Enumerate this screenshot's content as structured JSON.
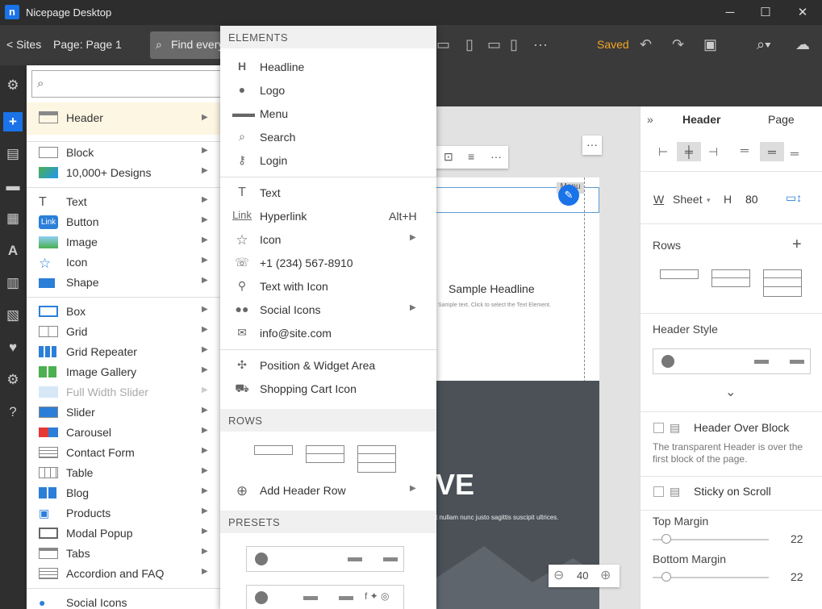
{
  "app": {
    "title": "Nicepage Desktop",
    "logo_letter": "n"
  },
  "toolbar": {
    "sites": "< Sites",
    "page": "Page: Page 1",
    "find_placeholder": "Find every",
    "status": "Saved"
  },
  "menu1": {
    "search_placeholder": "",
    "items": [
      {
        "label": "Header"
      },
      {
        "label": "Block"
      },
      {
        "label": "10,000+ Designs"
      },
      {
        "label": "Text"
      },
      {
        "label": "Button",
        "icon_text": "Link"
      },
      {
        "label": "Image"
      },
      {
        "label": "Icon"
      },
      {
        "label": "Shape"
      },
      {
        "label": "Box"
      },
      {
        "label": "Grid"
      },
      {
        "label": "Grid Repeater"
      },
      {
        "label": "Image Gallery"
      },
      {
        "label": "Full Width Slider"
      },
      {
        "label": "Slider"
      },
      {
        "label": "Carousel"
      },
      {
        "label": "Contact Form"
      },
      {
        "label": "Table"
      },
      {
        "label": "Blog"
      },
      {
        "label": "Products"
      },
      {
        "label": "Modal Popup"
      },
      {
        "label": "Tabs"
      },
      {
        "label": "Accordion and FAQ"
      },
      {
        "label": "Social Icons"
      }
    ]
  },
  "menu2": {
    "elements_header": "ELEMENTS",
    "items": [
      {
        "label": "Headline",
        "icon": "H"
      },
      {
        "label": "Logo"
      },
      {
        "label": "Menu"
      },
      {
        "label": "Search"
      },
      {
        "label": "Login"
      },
      {
        "label": "Text",
        "icon": "T"
      },
      {
        "label": "Hyperlink",
        "icon": "Link",
        "shortcut": "Alt+H"
      },
      {
        "label": "Icon"
      },
      {
        "label": "+1 (234) 567-8910"
      },
      {
        "label": "Text with Icon"
      },
      {
        "label": "Social Icons"
      },
      {
        "label": "info@site.com"
      },
      {
        "label": "Position & Widget Area"
      },
      {
        "label": "Shopping Cart Icon"
      }
    ],
    "rows_header": "ROWS",
    "add_row": "Add Header Row",
    "presets_header": "PRESETS"
  },
  "canvas": {
    "menu_tag": "Menu",
    "headline": "Sample Headline",
    "sample_text": "Sample text. Click to select the Text Element.",
    "big_text": "VE",
    "dark_text": "t nullam nunc justo sagittis suscipit ultrices.",
    "zoom": "40"
  },
  "rightpanel": {
    "tab_header": "Header",
    "tab_page": "Page",
    "width_label": "W",
    "sheet": "Sheet",
    "height_label": "H",
    "height_value": "80",
    "rows_title": "Rows",
    "style_title": "Header Style",
    "over_block": "Header Over Block",
    "over_block_desc": "The transparent Header is over the first block of the page.",
    "sticky": "Sticky on Scroll",
    "top_margin": "Top Margin",
    "top_margin_value": "22",
    "bottom_margin": "Bottom Margin",
    "bottom_margin_value": "22"
  },
  "colors": {
    "accent": "#1a73e8",
    "saved": "#f5a623",
    "header_highlight": "#fdf6e3"
  }
}
